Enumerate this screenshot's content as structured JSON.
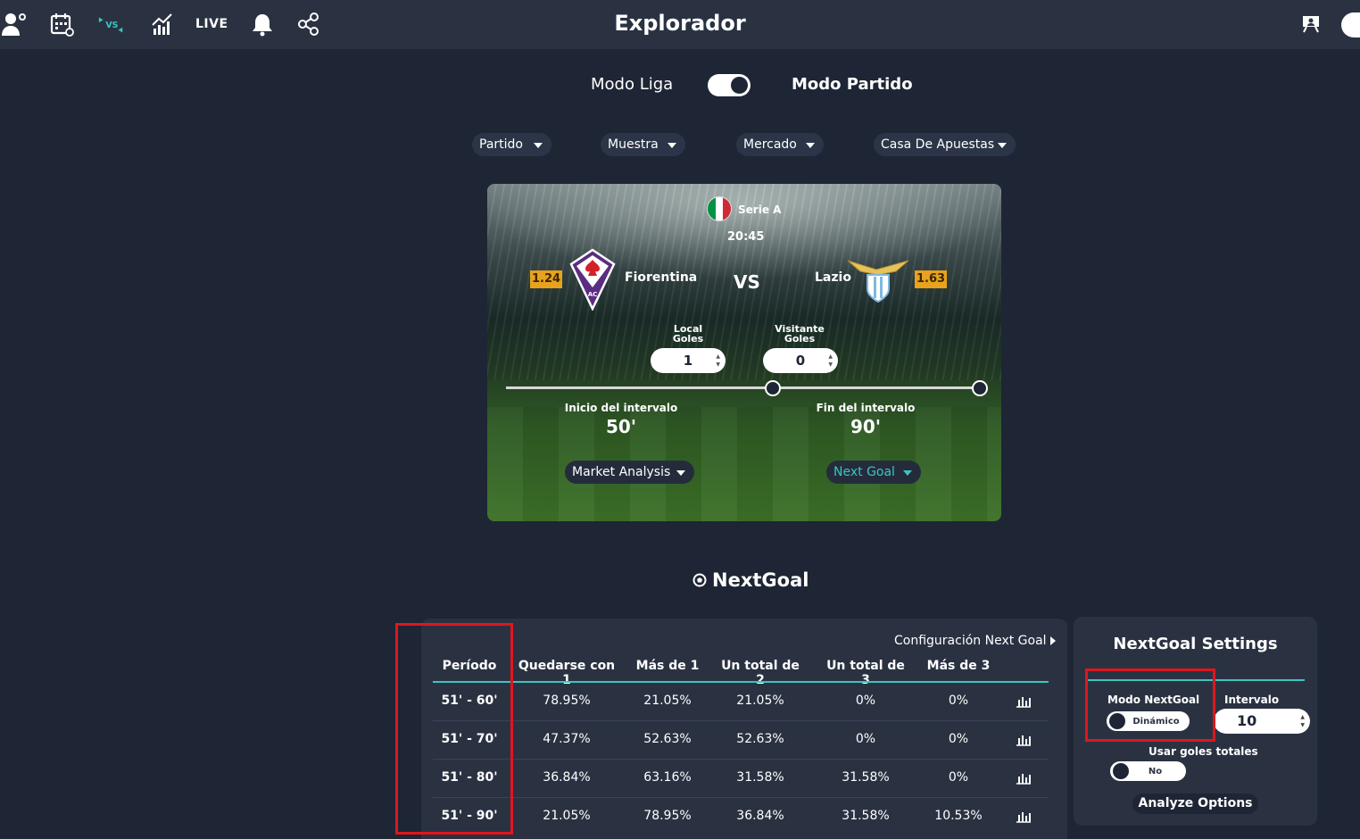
{
  "topbar": {
    "title": "Explorador",
    "live_label": "LIVE",
    "icons": [
      "users-settings-icon",
      "calendar-icon",
      "versus-icon",
      "stats-chart-icon",
      "bell-icon",
      "share-icon",
      "presentation-icon"
    ]
  },
  "mode": {
    "left_label": "Modo Liga",
    "right_label": "Modo Partido",
    "toggle_on": true
  },
  "filters": [
    {
      "label": "Partido"
    },
    {
      "label": "Muestra"
    },
    {
      "label": "Mercado"
    },
    {
      "label": "Casa De Apuestas"
    }
  ],
  "match": {
    "league": "Serie A",
    "time": "20:45",
    "vs_label": "VS",
    "home": {
      "name": "Fiorentina",
      "odds": "1.24"
    },
    "away": {
      "name": "Lazio",
      "odds": "1.63"
    },
    "home_goals_label_1": "Local",
    "home_goals_label_2": "Goles",
    "away_goals_label_1": "Visitante",
    "away_goals_label_2": "Goles",
    "home_goals": "1",
    "away_goals": "0",
    "interval_start_label": "Inicio del intervalo",
    "interval_start_value": "50'",
    "interval_end_label": "Fin del intervalo",
    "interval_end_value": "90'",
    "analysis_select": "Market Analysis",
    "market_select": "Next Goal"
  },
  "section": {
    "title": "NextGoal"
  },
  "table": {
    "config_link": "Configuración Next Goal",
    "headers": [
      "Período",
      "Quedarse con 1",
      "Más de 1",
      "Un total de 2",
      "Un total de 3",
      "Más de 3"
    ],
    "rows": [
      [
        "51' - 60'",
        "78.95%",
        "21.05%",
        "21.05%",
        "0%",
        "0%"
      ],
      [
        "51' - 70'",
        "47.37%",
        "52.63%",
        "52.63%",
        "0%",
        "0%"
      ],
      [
        "51' - 80'",
        "36.84%",
        "63.16%",
        "31.58%",
        "31.58%",
        "0%"
      ],
      [
        "51' - 90'",
        "21.05%",
        "78.95%",
        "36.84%",
        "31.58%",
        "10.53%"
      ]
    ]
  },
  "settings": {
    "title": "NextGoal Settings",
    "mode_label": "Modo NextGoal",
    "mode_value": "Dinámico",
    "interval_label": "Intervalo",
    "interval_value": "10",
    "total_goals_label": "Usar goles totales",
    "total_goals_value": "No",
    "analyze_button": "Analyze Options"
  },
  "colors": {
    "background": "#1e2535",
    "panel": "#2a3242",
    "accent": "#3bc5c0",
    "odds_badge": "#e8a21b",
    "highlight_box": "#e0161c"
  }
}
